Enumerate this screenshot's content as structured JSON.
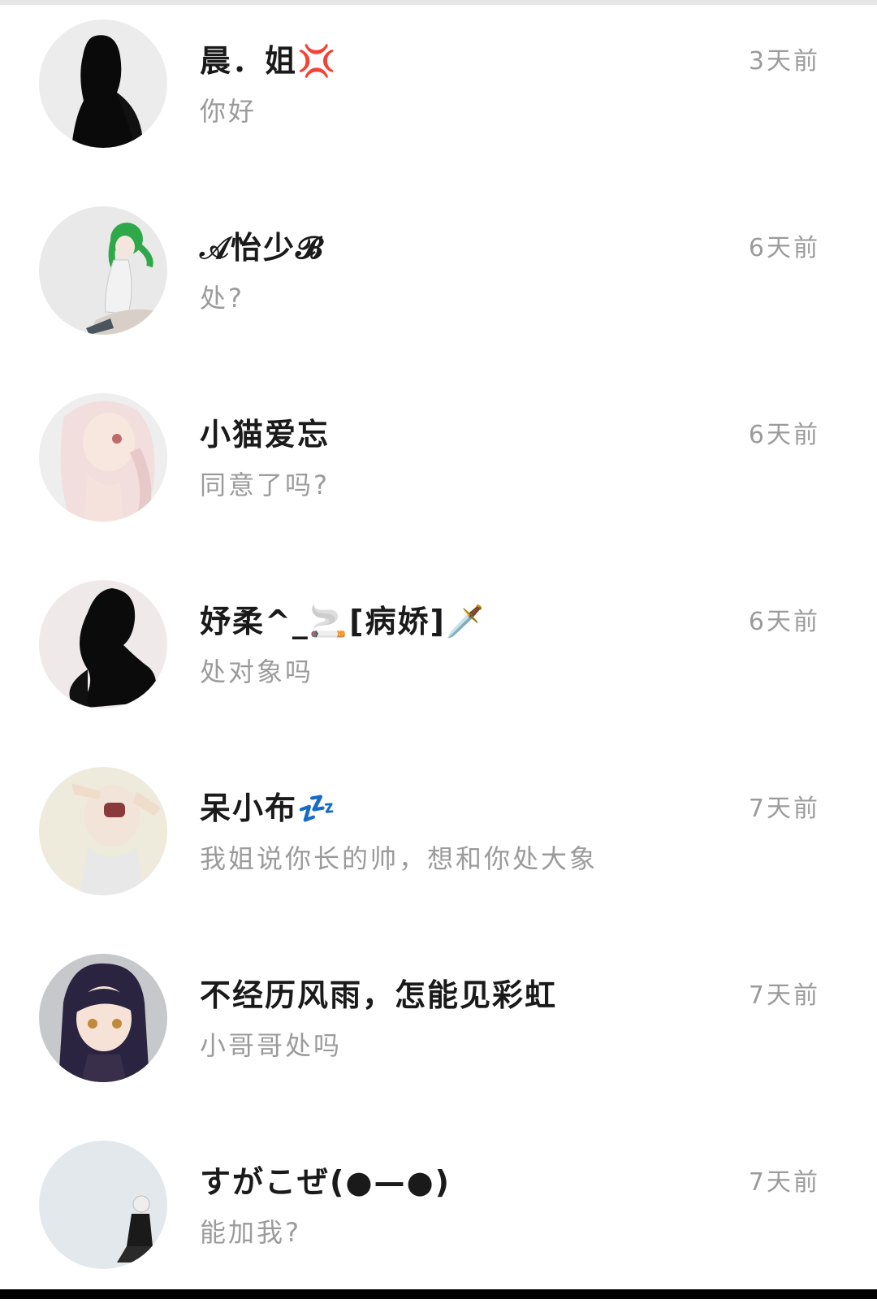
{
  "conversations": [
    {
      "name": "晨．姐💢",
      "message": "你好",
      "time": "3天前",
      "avatar_bg": "#ececec"
    },
    {
      "name": "𝒜怡少𝓑",
      "message": "处?",
      "time": "6天前",
      "avatar_bg": "#e9e9e9"
    },
    {
      "name": "小猫爱忘",
      "message": "同意了吗?",
      "time": "6天前",
      "avatar_bg": "#eeeeee"
    },
    {
      "name": "妤柔^_🚬[病娇]🗡️",
      "message": "处对象吗",
      "time": "6天前",
      "avatar_bg": "#f0e9e9"
    },
    {
      "name": "呆小布💤",
      "message": "我姐说你长的帅，想和你处大象",
      "time": "7天前",
      "avatar_bg": "#eeeadc"
    },
    {
      "name": "不经历风雨，怎能见彩虹",
      "message": "小哥哥处吗",
      "time": "7天前",
      "avatar_bg": "#c6c8cc"
    },
    {
      "name": "すがこぜ(●—●)",
      "message": "能加我?",
      "time": "7天前",
      "avatar_bg": "#e3e8ec"
    }
  ]
}
